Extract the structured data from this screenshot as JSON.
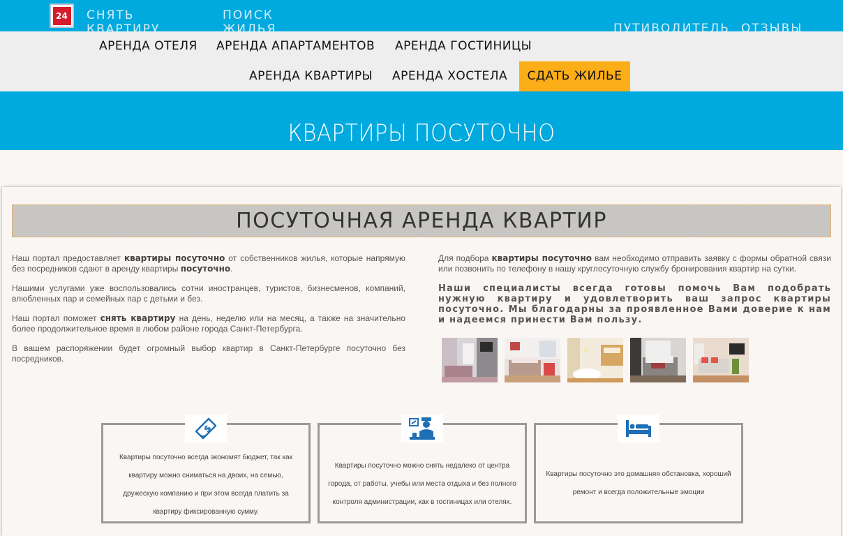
{
  "header": {
    "logo_text": "24",
    "links": [
      "СНЯТЬ КВАРТИРУ",
      "ПОИСК ЖИЛЬЯ",
      "ПУТИВОДИТЕЛЬ",
      "ОТЗЫВЫ"
    ]
  },
  "menu": {
    "items": [
      "АРЕНДА ОТЕЛЯ",
      "АРЕНДА АПАРТАМЕНТОВ",
      "АРЕНДА ГОСТИНИЦЫ",
      "АРЕНДА КВАРТИРЫ",
      "АРЕНДА ХОСТЕЛА"
    ],
    "cta": "СДАТЬ ЖИЛЬЕ"
  },
  "hero": {
    "title": "КВАРТИРЫ ПОСУТОЧНО"
  },
  "section": {
    "title": "ПОСУТОЧНАЯ АРЕНДА КВАРТИР"
  },
  "left": {
    "p1a": "Наш портал предоставляет ",
    "p1b": "квартиры посуточно",
    "p1c": " от собственников жилья, которые напрямую без посредников сдают в аренду квартиры ",
    "p1d": "посуточно",
    "p1e": ".",
    "p2": "Нашими услугами уже воспользовались сотни иностранцев, туристов, бизнесменов, компаний, влюбленных пар и семейных пар с детьми и без.",
    "p3a": "Наш портал поможет ",
    "p3b": "снять квартиру",
    "p3c": " на день, неделю или на месяц, а также на значительно более продолжительное время в любом районе города Санкт-Петербурга.",
    "p4": "В вашем распоряжении будет огромный выбор квартир в Санкт-Петербурге посуточно без посредников."
  },
  "right": {
    "p1a": "Для подбора ",
    "p1b": "квартиры посуточно",
    "p1c": " вам необходимо отправить заявку с формы обратной связи или позвонить по телефону в нашу круглосуточную службу бронирования квартир на сутки.",
    "p2": "Наши специалисты всегда готовы помочь Вам подобрать нужную квартиру и удовлетворить ваш запрос квартиры посуточно. Мы благодарны за проявленное Вами доверие к нам и надеемся принести Вам пользу."
  },
  "features": [
    {
      "icon": "money-icon",
      "text": "Квартиры посуточно всегда экономят бюджет, так как квартиру можно сниматься на двоих, на семью, дружескую компанию и при этом всегда платить за квартиру фиксированную сумму."
    },
    {
      "icon": "concierge-icon",
      "text": "Квартиры посуточно можно снять недалеко от центра города, от работы, учебы или места отдыха и без полного контроля администрации, как в гостиницах или отелях."
    },
    {
      "icon": "bed-icon",
      "text": "Квартиры посуточно это домашняя обстановка, хороший ремонт и всегда положительные эмоции"
    }
  ],
  "colors": {
    "brand_blue": "#00a9de",
    "cta_orange": "#fbae17",
    "icon_blue": "#1f6fb5"
  }
}
